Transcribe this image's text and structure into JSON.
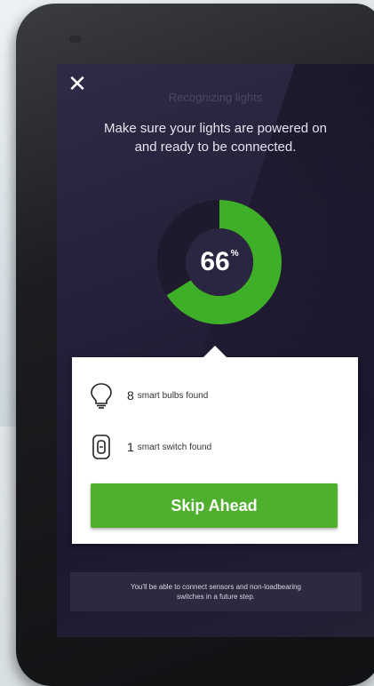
{
  "screen": {
    "faded_title": "Recognizing lights",
    "close_icon": "close-icon",
    "instruction_line1": "Make sure your lights are powered on",
    "instruction_line2": "and ready to be connected.",
    "progress": {
      "value": 66,
      "percent_sign": "%"
    },
    "results": [
      {
        "icon": "lightbulb-icon",
        "count": "8",
        "label": "smart bulbs found"
      },
      {
        "icon": "smart-switch-icon",
        "count": "1",
        "label": "smart switch found"
      }
    ],
    "skip_button_label": "Skip Ahead",
    "footer_line1": "You'll be able to connect sensors and non-loadbearing",
    "footer_line2": "switches in a future step."
  },
  "colors": {
    "accent_green": "#4fb02d",
    "progress_green": "#3fae29",
    "screen_background": "#251f39"
  }
}
